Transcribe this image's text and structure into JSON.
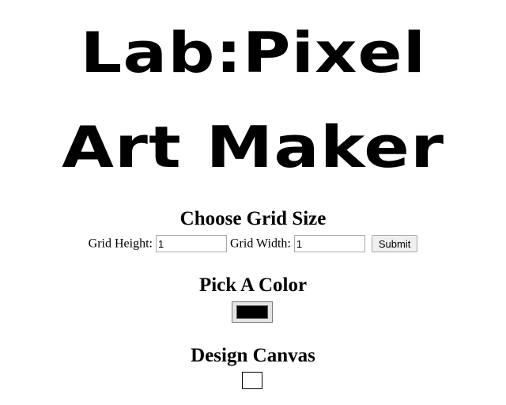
{
  "logo": {
    "line1": "Lab:Pixel",
    "line2": "Art Maker"
  },
  "grid_section": {
    "heading": "Choose Grid Size",
    "height_label": "Grid Height:",
    "height_value": "1",
    "width_label": "Grid Width:",
    "width_value": "1",
    "submit_label": "Submit"
  },
  "color_section": {
    "heading": "Pick A Color",
    "selected_color": "#000000"
  },
  "canvas_section": {
    "heading": "Design Canvas",
    "rows": 1,
    "cols": 1
  }
}
